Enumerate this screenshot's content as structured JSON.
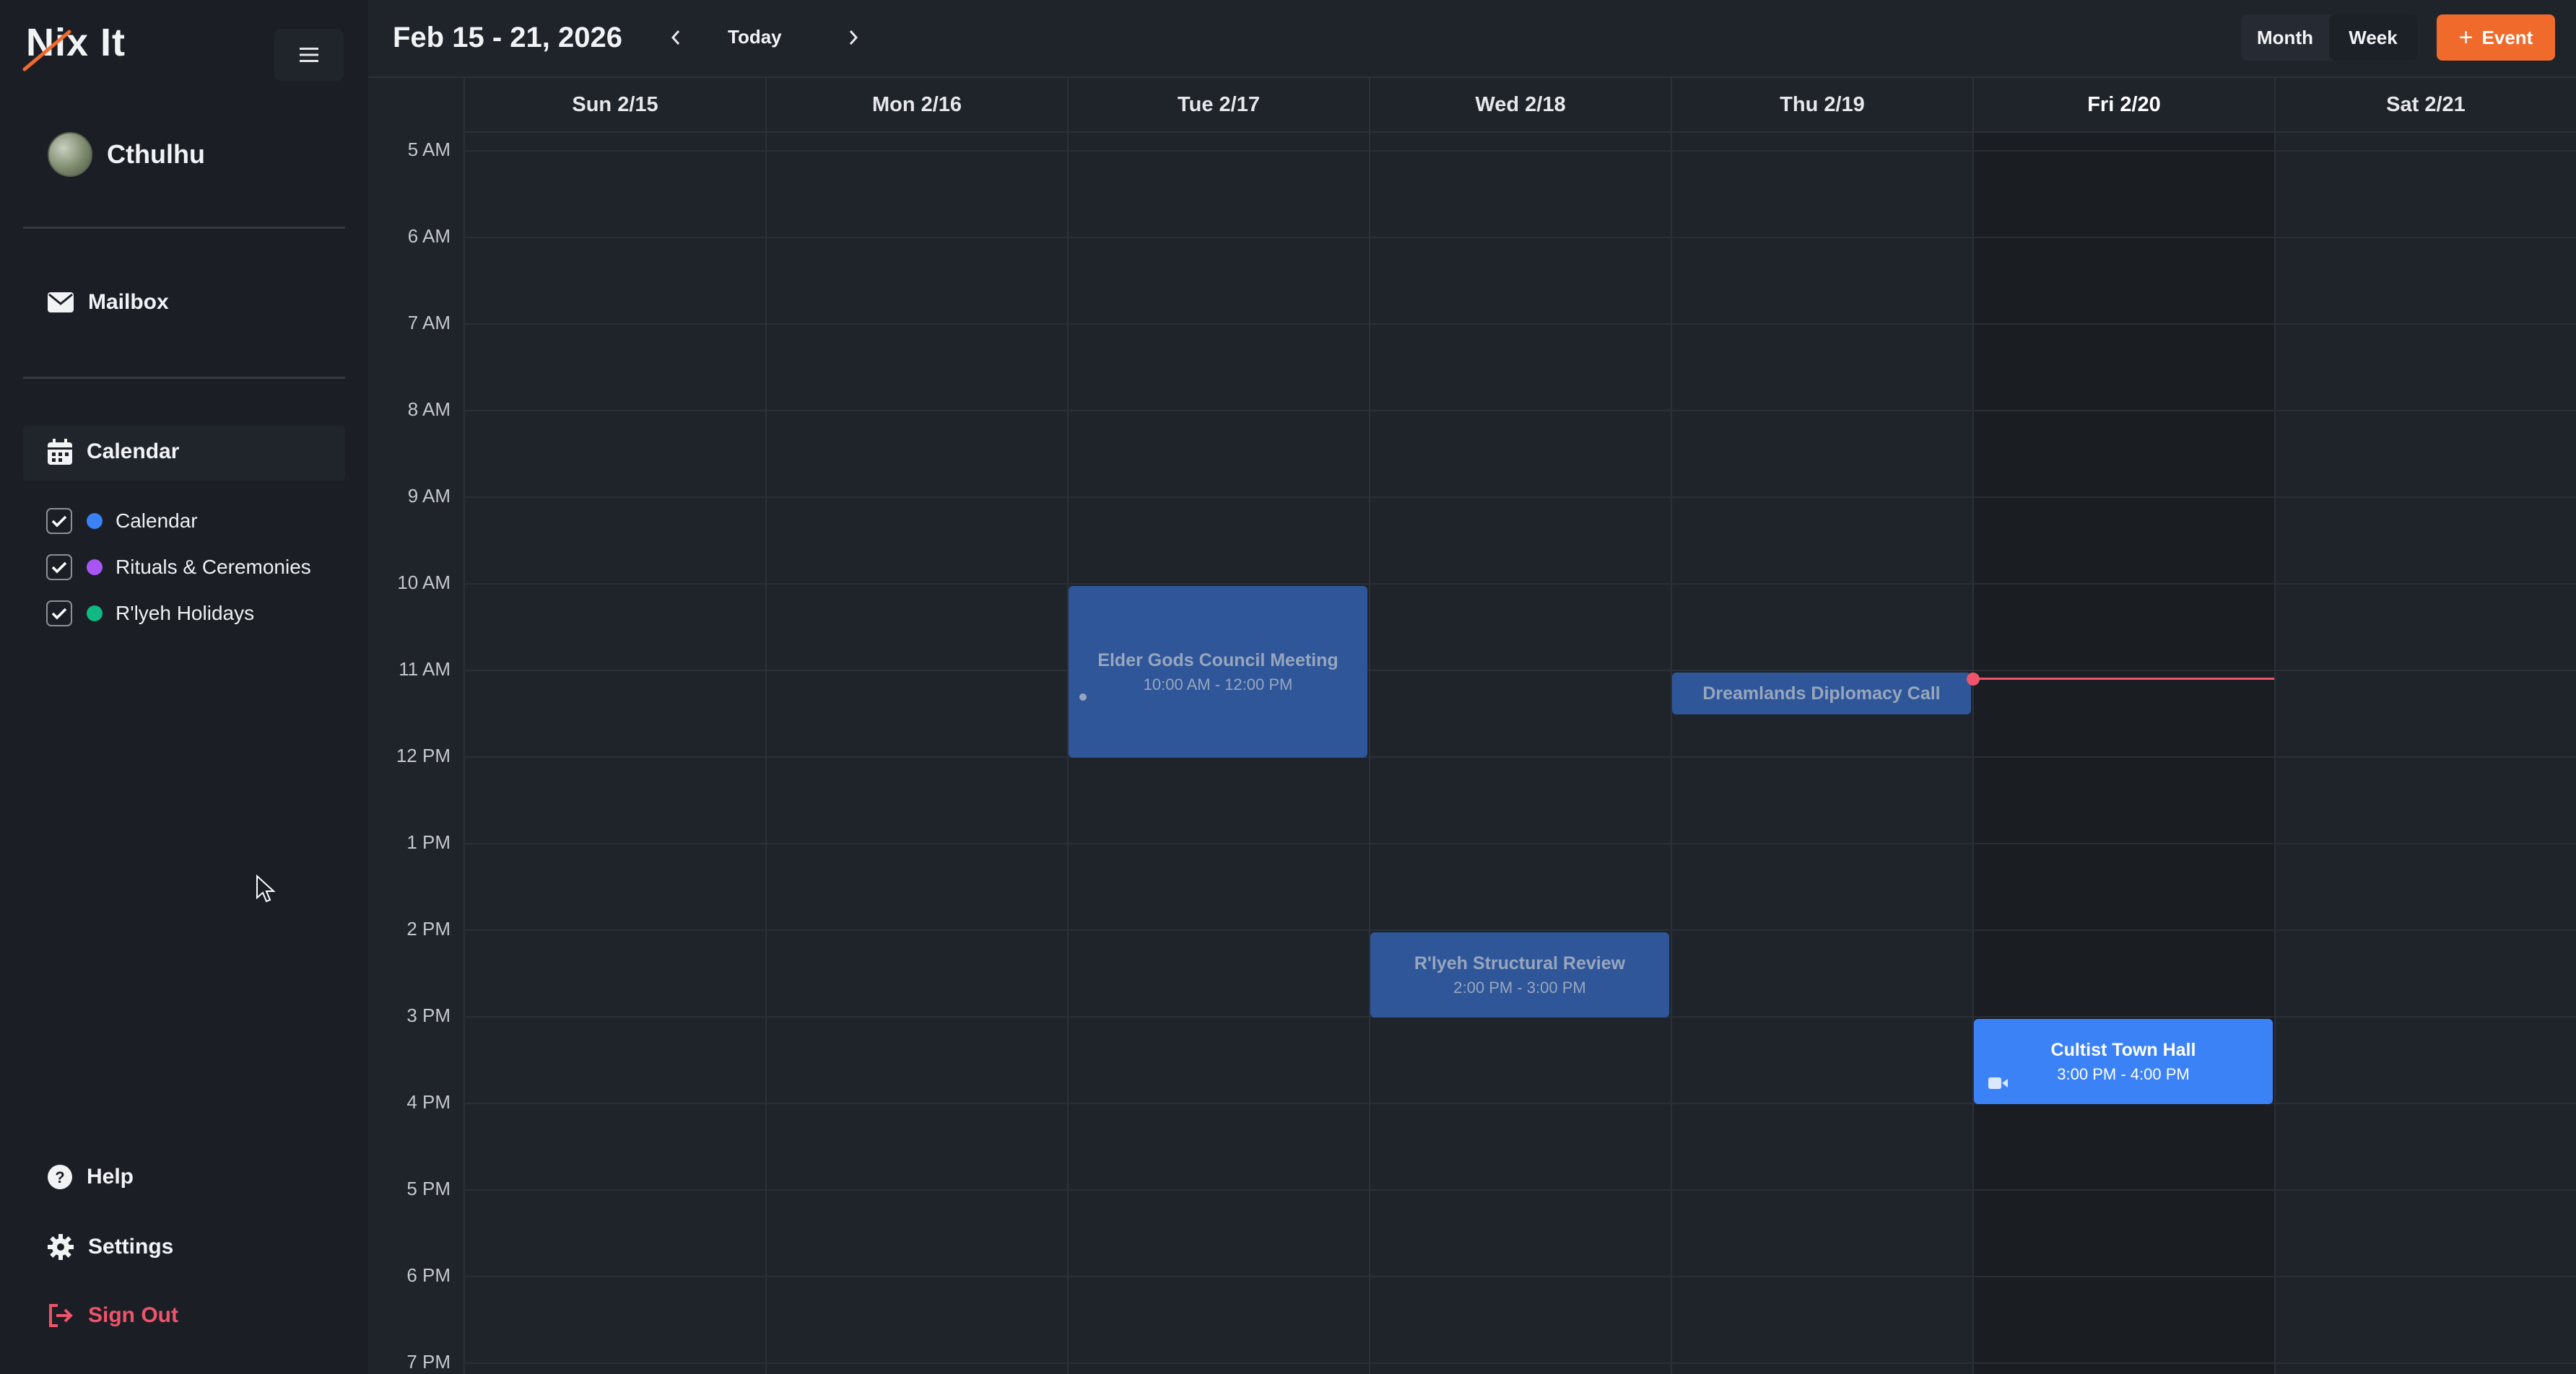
{
  "app": {
    "logo_text": "Nix It"
  },
  "user": {
    "name": "Cthulhu"
  },
  "sidebar": {
    "mailbox_label": "Mailbox",
    "calendar_label": "Calendar",
    "calendars": [
      {
        "label": "Calendar",
        "color": "#3b82f6",
        "checked": true
      },
      {
        "label": "Rituals & Ceremonies",
        "color": "#a855f7",
        "checked": true
      },
      {
        "label": "R'lyeh Holidays",
        "color": "#10b981",
        "checked": true
      }
    ],
    "help_label": "Help",
    "settings_label": "Settings",
    "signout_label": "Sign Out"
  },
  "header": {
    "range_title": "Feb 15 - 21, 2026",
    "today_label": "Today",
    "view_month": "Month",
    "view_week": "Week",
    "active_view": "Week",
    "add_event_label": "Event"
  },
  "week": {
    "days": [
      "Sun 2/15",
      "Mon 2/16",
      "Tue 2/17",
      "Wed 2/18",
      "Thu 2/19",
      "Fri 2/20",
      "Sat 2/21"
    ],
    "today_index": 5,
    "hours": [
      "5 AM",
      "6 AM",
      "7 AM",
      "8 AM",
      "9 AM",
      "10 AM",
      "11 AM",
      "12 PM",
      "1 PM",
      "2 PM",
      "3 PM",
      "4 PM",
      "5 PM",
      "6 PM",
      "7 PM"
    ]
  },
  "events": {
    "elder": {
      "title": "Elder Gods Council Meeting",
      "time": "10:00 AM - 12:00 PM"
    },
    "dreamlands": {
      "title": "Dreamlands Diplomacy Call"
    },
    "rlyeh": {
      "title": "R'lyeh Structural Review",
      "time": "2:00 PM - 3:00 PM"
    },
    "cultist": {
      "title": "Cultist Town Hall",
      "time": "3:00 PM - 4:00 PM"
    }
  },
  "colors": {
    "accent": "#f06b2b",
    "event_blue": "#3b82f6",
    "event_muted": "#2f5699",
    "now_indicator": "#f0546a"
  }
}
